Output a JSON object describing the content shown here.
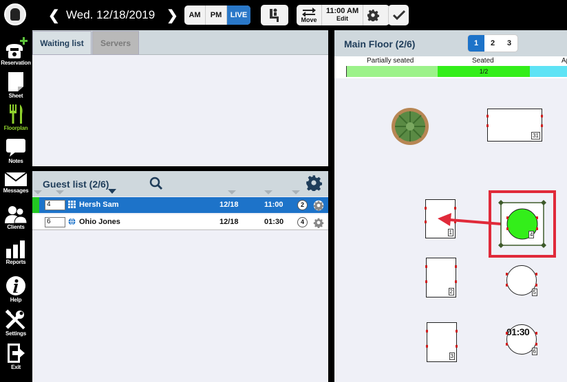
{
  "sidebar": {
    "items": [
      {
        "label": "Reservation"
      },
      {
        "label": "Sheet"
      },
      {
        "label": "Floorplan"
      },
      {
        "label": "Notes"
      },
      {
        "label": "Messages"
      },
      {
        "label": "Clients"
      },
      {
        "label": "Reports"
      },
      {
        "label": "Help"
      },
      {
        "label": "Settings"
      },
      {
        "label": "Exit"
      }
    ]
  },
  "topbar": {
    "date": "Wed. 12/18/2019",
    "am": "AM",
    "pm": "PM",
    "live": "LIVE",
    "move": "Move",
    "edit_time": "11:00 AM",
    "edit": "Edit"
  },
  "waiting": {
    "tab_waiting": "Waiting list",
    "tab_servers": "Servers"
  },
  "guest": {
    "title": "Guest list (2/6)",
    "rows": [
      {
        "qty": "4",
        "name": "Hersh Sam",
        "date": "12/18",
        "time": "11:00",
        "party": "2"
      },
      {
        "qty": "6",
        "name": "Ohio Jones",
        "date": "12/18",
        "time": "01:30",
        "party": "4"
      }
    ]
  },
  "floor": {
    "title": "Main Floor (2/6)",
    "pages": [
      "1",
      "2",
      "3"
    ],
    "status_partial": "Partially seated",
    "status_seated": "Seated",
    "status_ap": "Ap",
    "seated_count": "1/2",
    "tables": {
      "t31": "31",
      "t1": "1",
      "t4": "4",
      "t2": "2",
      "t5": "5",
      "t3": "3",
      "t6": "6",
      "t6_time": "01:30"
    }
  },
  "colors": {
    "accent": "#1d73c9",
    "seated": "#33ee1a",
    "partial": "#9cf28a",
    "approaching": "#5ee3f5",
    "highlight": "#e02a3a"
  }
}
